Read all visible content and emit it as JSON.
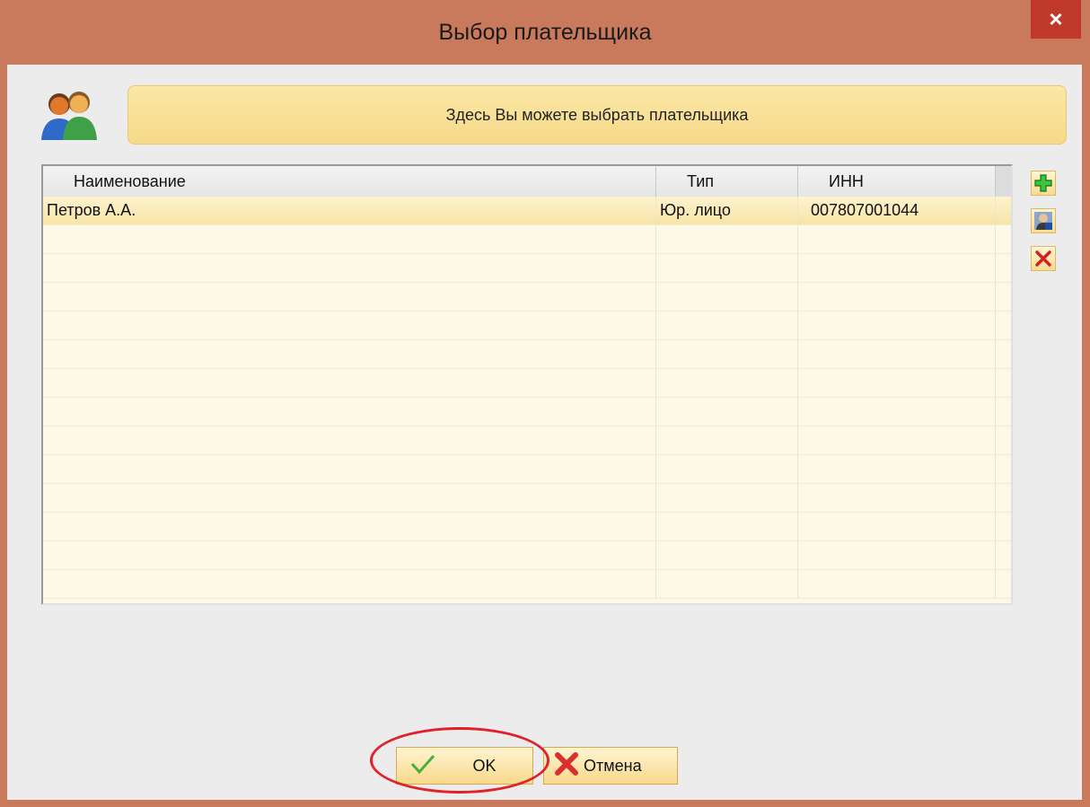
{
  "window": {
    "title": "Выбор плательщика",
    "close_glyph": "×"
  },
  "banner": {
    "text": "Здесь Вы можете выбрать плательщика"
  },
  "grid": {
    "columns": [
      "Наименование",
      "Тип",
      "ИНН"
    ],
    "rows": [
      {
        "name": "Петров А.А.",
        "type": "Юр. лицо",
        "inn": "007807001044",
        "selected": true
      }
    ],
    "empty_rows": 13
  },
  "side_buttons": [
    {
      "icon": "add-icon"
    },
    {
      "icon": "person-icon"
    },
    {
      "icon": "delete-icon"
    }
  ],
  "buttons": {
    "ok_label": "OK",
    "cancel_label": "Отмена"
  },
  "colors": {
    "titlebar": "#c97a5c",
    "close": "#c0392b",
    "banner": "#f6d98a",
    "grid_bg": "#fcfae6",
    "highlight": "#e0202a"
  }
}
